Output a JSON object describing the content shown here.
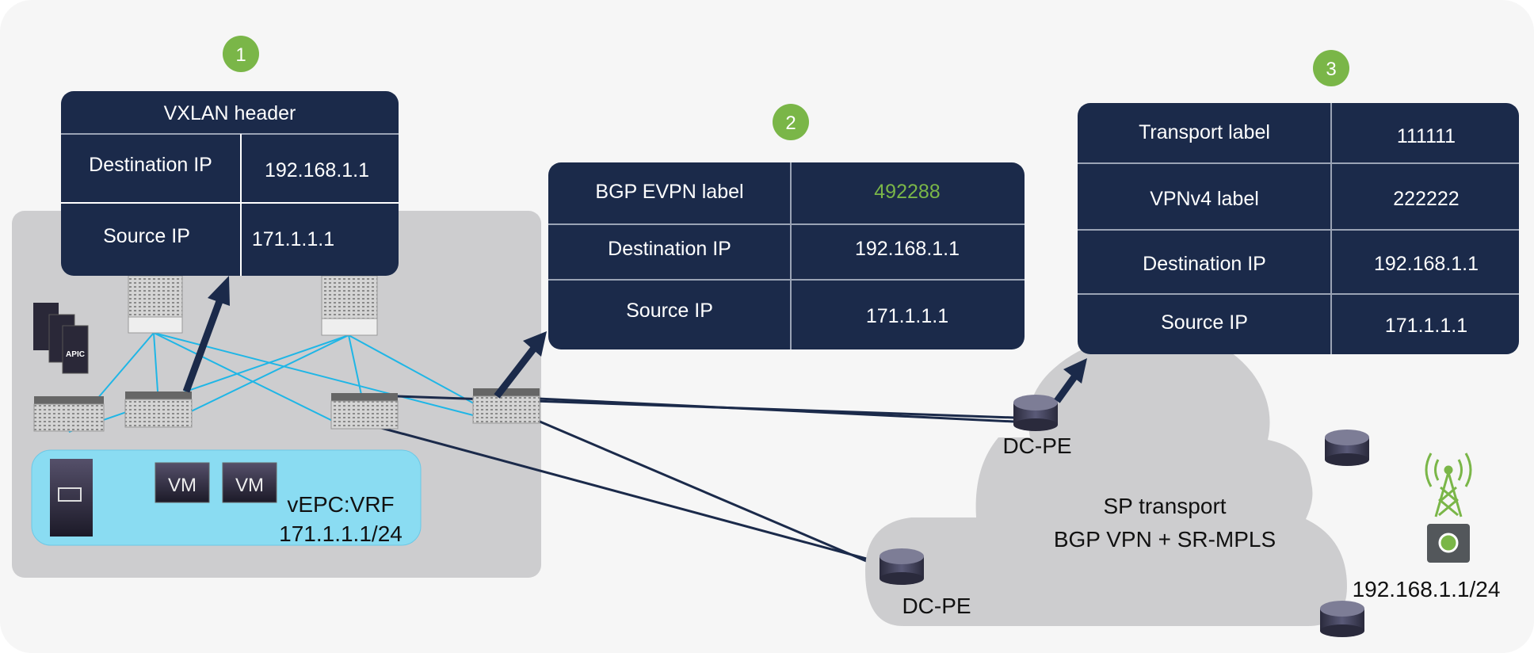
{
  "colors": {
    "navy": "#1b2a4a",
    "green": "#7ab648",
    "cyan": "#1fb6e6",
    "light_blue": "#8adcf2",
    "gray_panel": "#cdcdcf",
    "background": "#f6f6f6"
  },
  "steps": [
    "1",
    "2",
    "3"
  ],
  "vxlan_table": {
    "title": "VXLAN header",
    "rows": [
      {
        "label": "Destination IP",
        "value": "192.168.1.1"
      },
      {
        "label": "Source IP",
        "value": "171.1.1.1"
      }
    ]
  },
  "evpn_table": {
    "rows": [
      {
        "label": "BGP EVPN label",
        "value": "492288"
      },
      {
        "label": "Destination IP",
        "value": "192.168.1.1"
      },
      {
        "label": "Source IP",
        "value": "171.1.1.1"
      }
    ]
  },
  "mpls_table": {
    "rows": [
      {
        "label": "Transport label",
        "value": "111111"
      },
      {
        "label": "VPNv4 label",
        "value": "222222"
      },
      {
        "label": "Destination IP",
        "value": "192.168.1.1"
      },
      {
        "label": "Source IP",
        "value": "171.1.1.1"
      }
    ]
  },
  "datacenter": {
    "apic_label": "APIC",
    "vm_labels": [
      "VM",
      "VM"
    ],
    "vrf_name": "vEPC:VRF",
    "vrf_subnet": "171.1.1.1/24"
  },
  "sp": {
    "cloud_title": "SP transport",
    "cloud_subtitle": "BGP VPN + SR-MPLS",
    "pe_labels": [
      "DC-PE",
      "DC-PE"
    ],
    "remote_subnet": "192.168.1.1/24"
  }
}
